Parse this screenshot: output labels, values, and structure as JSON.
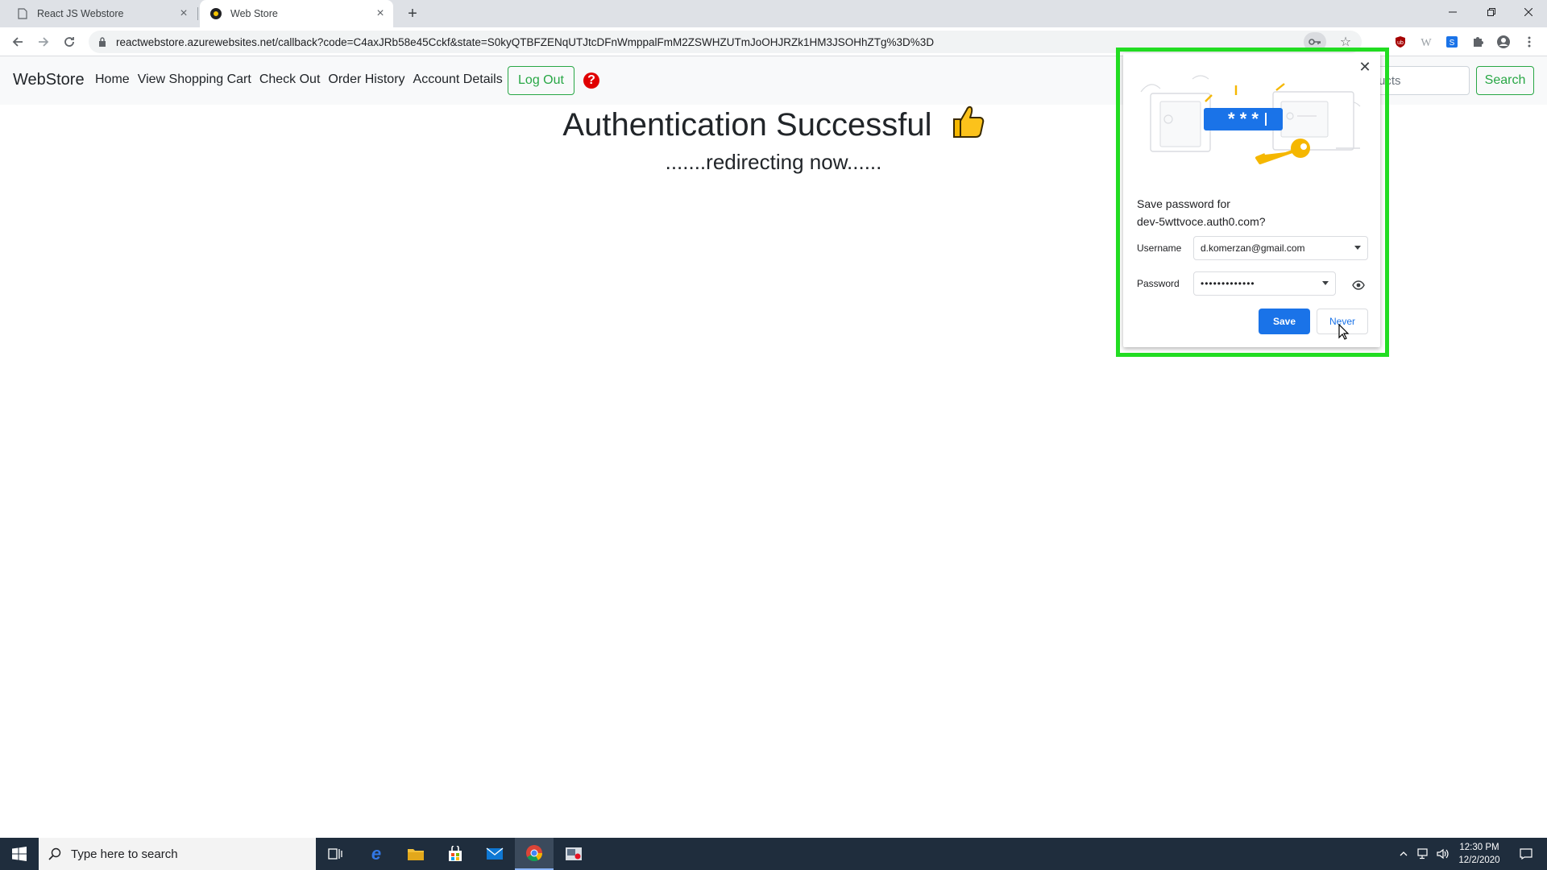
{
  "browser": {
    "tabs": [
      {
        "title": "React JS Webstore",
        "active": false
      },
      {
        "title": "Web Store",
        "active": true
      }
    ],
    "url": "reactwebstore.azurewebsites.net/callback?code=C4axJRb58e45Cckf&state=S0kyQTBFZENqUTJtcDFnWmppalFmM2ZSWHZUTmJoOHJRZk1HM3JSOHhZTg%3D%3D"
  },
  "navbar": {
    "brand": "WebStore",
    "links": [
      "Home",
      "View Shopping Cart",
      "Check Out",
      "Order History",
      "Account Details"
    ],
    "logout_label": "Log Out",
    "help_glyph": "?",
    "search_value": "ucts",
    "search_label": "Search"
  },
  "main": {
    "title": "Authentication Successful",
    "subtitle": ".......redirecting now......"
  },
  "password_popup": {
    "heading_line1": "Save password for",
    "heading_line2": "dev-5wttvoce.auth0.com?",
    "illustration_text": "* * *",
    "username_label": "Username",
    "username_value": "d.komerzan@gmail.com",
    "password_label": "Password",
    "password_value": "•••••••••••••",
    "save_label": "Save",
    "never_label": "Never"
  },
  "taskbar": {
    "search_placeholder": "Type here to search",
    "time": "12:30 PM",
    "date": "12/2/2020"
  },
  "colors": {
    "accent_green": "#28a745",
    "highlight_green": "#22dd22",
    "chrome_blue": "#1a73e8",
    "help_red": "#e00000"
  }
}
